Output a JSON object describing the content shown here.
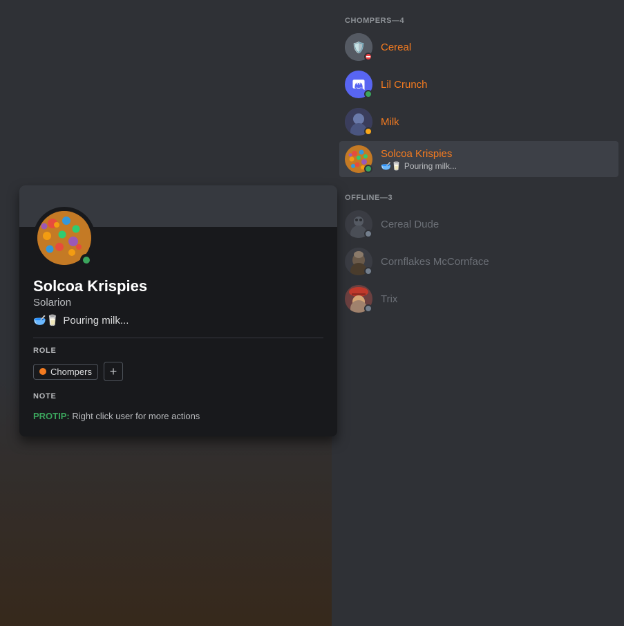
{
  "colors": {
    "accent": "#f47b20",
    "bg_dark": "#2f3136",
    "bg_darker": "#18191c",
    "bg_mid": "#36393f",
    "online": "#3ba55d",
    "dnd": "#ed4245",
    "idle": "#faa81a",
    "offline": "#747f8d",
    "muted": "#8e9297",
    "text_normal": "#dcddde",
    "text_muted": "#b9bbbe"
  },
  "right_panel": {
    "chompers_header": "CHOMPERS—4",
    "offline_header": "OFFLINE—3",
    "chompers_members": [
      {
        "name": "Cereal",
        "status": "dnd",
        "avatar_type": "cereal",
        "activity": null
      },
      {
        "name": "Lil Crunch",
        "status": "online",
        "avatar_type": "discord",
        "activity": null
      },
      {
        "name": "Milk",
        "status": "idle",
        "avatar_type": "milk",
        "activity": null
      },
      {
        "name": "Solcoa Krispies",
        "status": "online",
        "avatar_type": "solcoa",
        "activity_icon": "🥣🥛",
        "activity_text": "Pouring milk...",
        "active": true
      }
    ],
    "offline_members": [
      {
        "name": "Cereal Dude",
        "status": "offline",
        "avatar_type": "cereal_dude"
      },
      {
        "name": "Cornflakes McCornface",
        "status": "offline",
        "avatar_type": "cornflakes"
      },
      {
        "name": "Trix",
        "status": "offline",
        "avatar_type": "trix"
      }
    ]
  },
  "profile": {
    "name": "Solcoa Krispies",
    "discriminator": "Solarion",
    "activity_icon": "🥣🥛",
    "activity_text": "Pouring milk...",
    "role_label": "ROLE",
    "role_name": "Chompers",
    "note_label": "NOTE",
    "protip_label": "PROTIP:",
    "protip_text": "Right click user for more actions"
  }
}
